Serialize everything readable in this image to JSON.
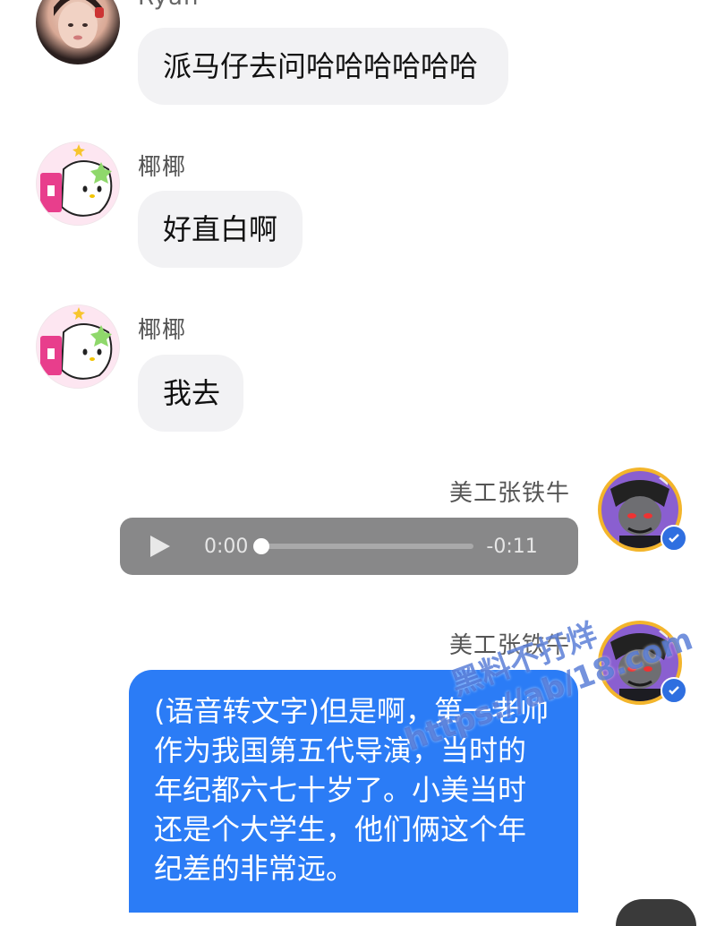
{
  "messages": [
    {
      "sender": "Ryan",
      "text": "派马仔去问哈哈哈哈哈哈"
    },
    {
      "sender": "椰椰",
      "text": "好直白啊"
    },
    {
      "sender": "椰椰",
      "text": "我去"
    },
    {
      "sender": "美工张铁牛",
      "type": "voice",
      "elapsed": "0:00",
      "remaining": "-0:11",
      "progress": 0
    },
    {
      "sender": "美工张铁牛",
      "text_lines": [
        "(语音转文字)但是啊，第一老帅",
        "作为我国第五代导演，当时的",
        "年纪都六七十岁了。小美当时",
        "还是个大学生，他们俩这个年",
        "纪差的非常远。"
      ]
    }
  ],
  "watermark": {
    "line1": "黑料不打烊",
    "line2": "https://ab/18.com"
  },
  "colors": {
    "bubble_gray": "#f2f2f4",
    "bubble_blue": "#2b7cf6",
    "voice_bg": "#888889",
    "verified": "#2f6fe0"
  },
  "icons": [
    "play-icon",
    "verified-badge-icon"
  ]
}
